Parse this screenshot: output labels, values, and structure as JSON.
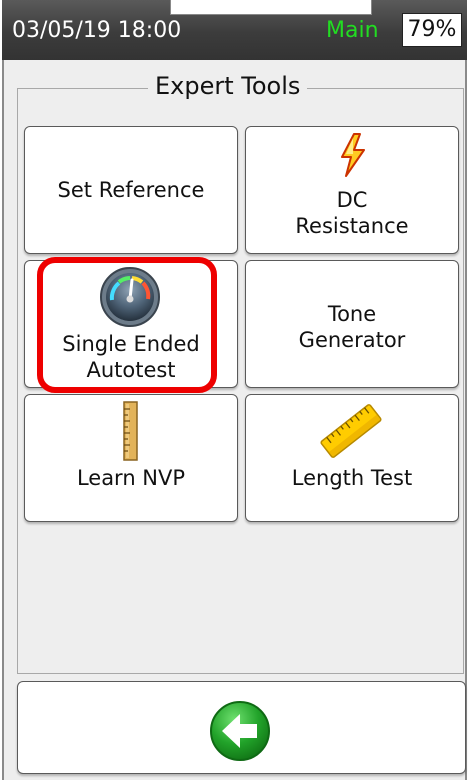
{
  "status_bar": {
    "datetime": "03/05/19 18:00",
    "mode": "Main",
    "battery": "79%"
  },
  "expert_tools": {
    "title": "Expert Tools",
    "tiles": [
      {
        "label": "Set Reference"
      },
      {
        "label": "DC\nResistance",
        "icon": "lightning-bolt-icon"
      },
      {
        "label": "Single Ended\nAutotest",
        "icon": "gauge-icon"
      },
      {
        "label": "Tone\nGenerator"
      },
      {
        "label": "Learn NVP",
        "icon": "ruler-vertical-icon"
      },
      {
        "label": "Length Test",
        "icon": "ruler-diagonal-icon"
      }
    ]
  },
  "nav": {
    "back_icon": "back-arrow-icon"
  },
  "colors": {
    "status_bg": "#3c3c3c",
    "mode_text": "#22dd22",
    "highlight": "#ee0000",
    "panel_bg": "#eeeeee"
  }
}
